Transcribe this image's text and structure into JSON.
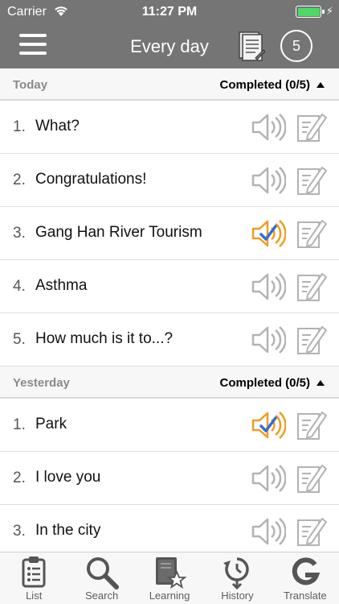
{
  "status_bar": {
    "carrier": "Carrier",
    "time": "11:27 PM"
  },
  "nav": {
    "title": "Every day",
    "count": "5"
  },
  "sections": [
    {
      "label": "Today",
      "status": "Completed (0/5)",
      "items": [
        {
          "num": "1.",
          "text": "What?",
          "played": false
        },
        {
          "num": "2.",
          "text": "Congratulations!",
          "played": false
        },
        {
          "num": "3.",
          "text": "Gang Han River Tourism",
          "played": true
        },
        {
          "num": "4.",
          "text": "Asthma",
          "played": false
        },
        {
          "num": "5.",
          "text": "How much is it to...?",
          "played": false
        }
      ]
    },
    {
      "label": "Yesterday",
      "status": "Completed (0/5)",
      "items": [
        {
          "num": "1.",
          "text": "Park",
          "played": true
        },
        {
          "num": "2.",
          "text": "I love you",
          "played": false
        },
        {
          "num": "3.",
          "text": "In the city",
          "played": false
        }
      ]
    }
  ],
  "tabs": [
    {
      "label": "List",
      "icon": "clipboard-list-icon"
    },
    {
      "label": "Search",
      "icon": "magnifier-icon"
    },
    {
      "label": "Learning",
      "icon": "book-star-icon"
    },
    {
      "label": "History",
      "icon": "clock-history-icon"
    },
    {
      "label": "Translate",
      "icon": "google-g-icon"
    }
  ],
  "colors": {
    "header": "#757575",
    "speaker_idle": "#b3b3b3",
    "speaker_played": "#f39c1f",
    "check": "#2f6fd6",
    "battery": "#4cd964"
  }
}
